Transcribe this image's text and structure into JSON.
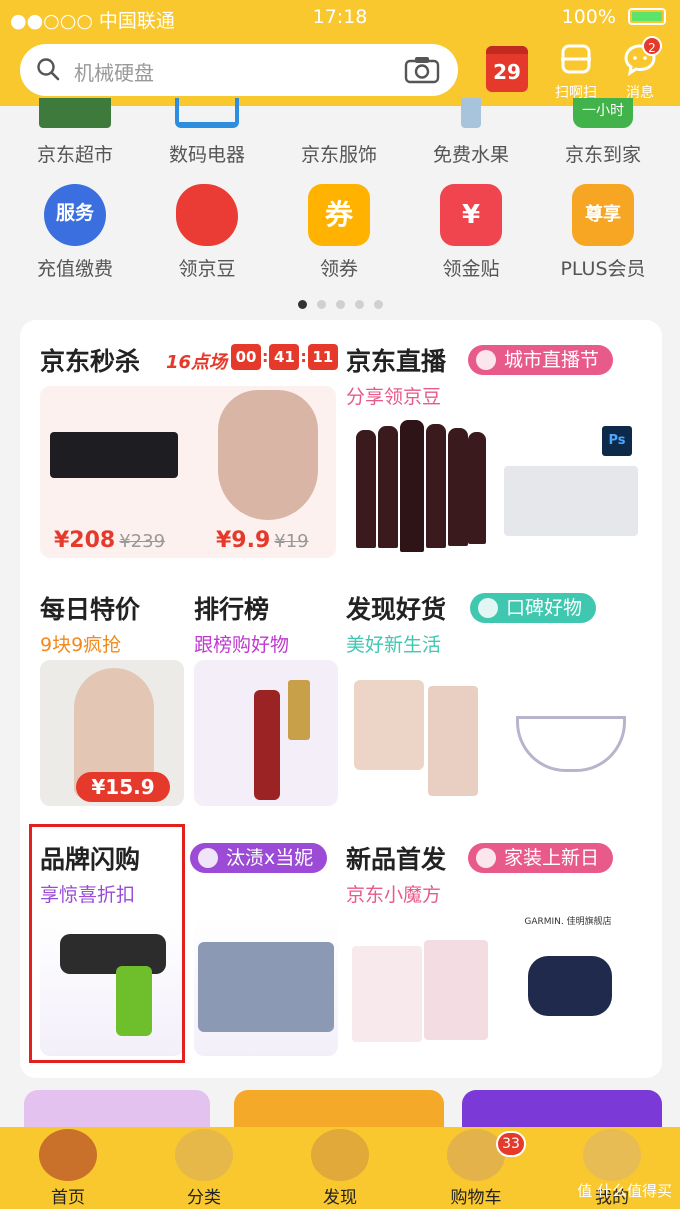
{
  "status_bar": {
    "carrier": "●●○○○ 中国联通",
    "time": "17:18",
    "battery": "100%"
  },
  "header": {
    "search_placeholder": "机械硬盘",
    "calendar_day": "29",
    "scan_label": "扫啊扫",
    "message_label": "消息",
    "message_badge": "2"
  },
  "grid": {
    "row1": [
      "京东超市",
      "数码电器",
      "京东服饰",
      "免费水果",
      "京东到家"
    ],
    "row2": [
      "充值缴费",
      "领京豆",
      "领券",
      "领金贴",
      "PLUS会员"
    ],
    "row2_icon_text": [
      "服务",
      "",
      "券",
      "¥",
      "尊享"
    ],
    "row1_partial_badge": "一小时"
  },
  "seckill": {
    "title": "京东秒杀",
    "session": "16点场",
    "timer": [
      "00",
      "41",
      "11"
    ],
    "items": [
      {
        "price": "¥208",
        "orig": "¥239"
      },
      {
        "price": "¥9.9",
        "orig": "¥19"
      }
    ]
  },
  "live": {
    "title": "京东直播",
    "pill": "城市直播节",
    "subtitle": "分享领京豆"
  },
  "daily": {
    "title": "每日特价",
    "subtitle": "9块9疯抢",
    "price": "¥15.9"
  },
  "rank": {
    "title": "排行榜",
    "subtitle": "跟榜购好物"
  },
  "goods": {
    "title": "发现好货",
    "pill": "口碑好物",
    "subtitle": "美好新生活"
  },
  "brand": {
    "title": "品牌闪购",
    "pill": "汰渍x当妮",
    "subtitle": "享惊喜折扣"
  },
  "newprod": {
    "title": "新品首发",
    "pill": "家装上新日",
    "subtitle": "京东小魔方",
    "garmin_label": "GARMIN. 佳明旗舰店"
  },
  "tabbar": {
    "tabs": [
      "首页",
      "分类",
      "发现",
      "购物车",
      "我的"
    ],
    "cart_badge": "33"
  },
  "watermark": "值 什么值得买",
  "colors": {
    "brand_yellow": "#f9c72e",
    "red": "#e53a2b",
    "purple": "#9b4bd6",
    "teal": "#3fc7b0",
    "pink": "#e85a8a"
  }
}
